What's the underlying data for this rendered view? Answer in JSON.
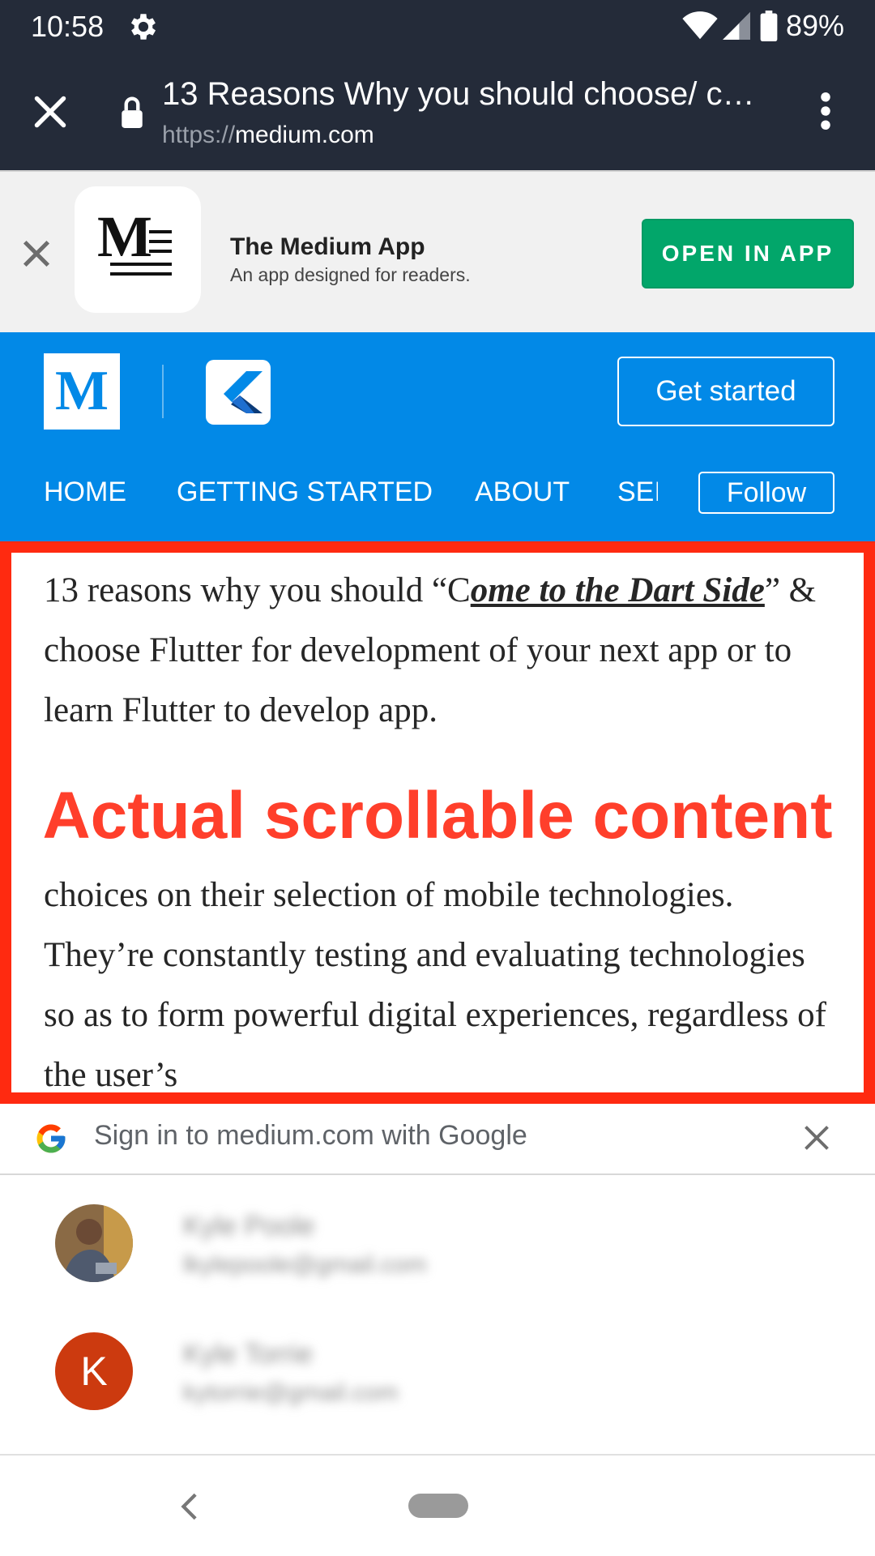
{
  "status_bar": {
    "time": "10:58",
    "battery": "89%",
    "icons": [
      "gear-icon",
      "wifi-icon",
      "signal-icon",
      "battery-icon"
    ]
  },
  "custom_tab": {
    "title": "13 Reasons Why you should choose/ c…",
    "url_scheme": "https://",
    "url_host": "medium.com",
    "icons": [
      "close-icon",
      "lock-icon",
      "more-vert-icon"
    ]
  },
  "app_banner": {
    "app_name": "The Medium App",
    "subtitle": "An app designed for readers.",
    "open_button": "OPEN IN APP",
    "button_color": "#02a66a",
    "logo_text": "M"
  },
  "pub_header": {
    "background_color": "#0289e7",
    "logo_letter": "M",
    "get_started": "Get started",
    "nav": [
      "HOME",
      "GETTING STARTED",
      "ABOUT",
      "SEI"
    ],
    "follow": "Follow"
  },
  "article": {
    "p1_a": "13 reasons why you should “C",
    "p1_link": "ome to the Dart Side",
    "p1_b": "” & choose Flutter for development of your next app or to learn Flutter to develop app.",
    "p2": "choices on their selection of mobile technologies. They’re constantly testing and evaluating technologies so as to form powerful digital experiences, regardless of the user’s"
  },
  "overlay": {
    "label": "Actual scrollable content",
    "color": "#ff2a10"
  },
  "google_sheet": {
    "title": "Sign in to medium.com with Google",
    "accounts": [
      {
        "name": "Kyle Poole",
        "email": "lkylepoole@gmail.com",
        "avatar": "photo"
      },
      {
        "name": "Kyle Torrie",
        "email": "kytorrie@gmail.com",
        "avatar_letter": "K",
        "avatar_color": "#cc3a0f"
      }
    ]
  }
}
